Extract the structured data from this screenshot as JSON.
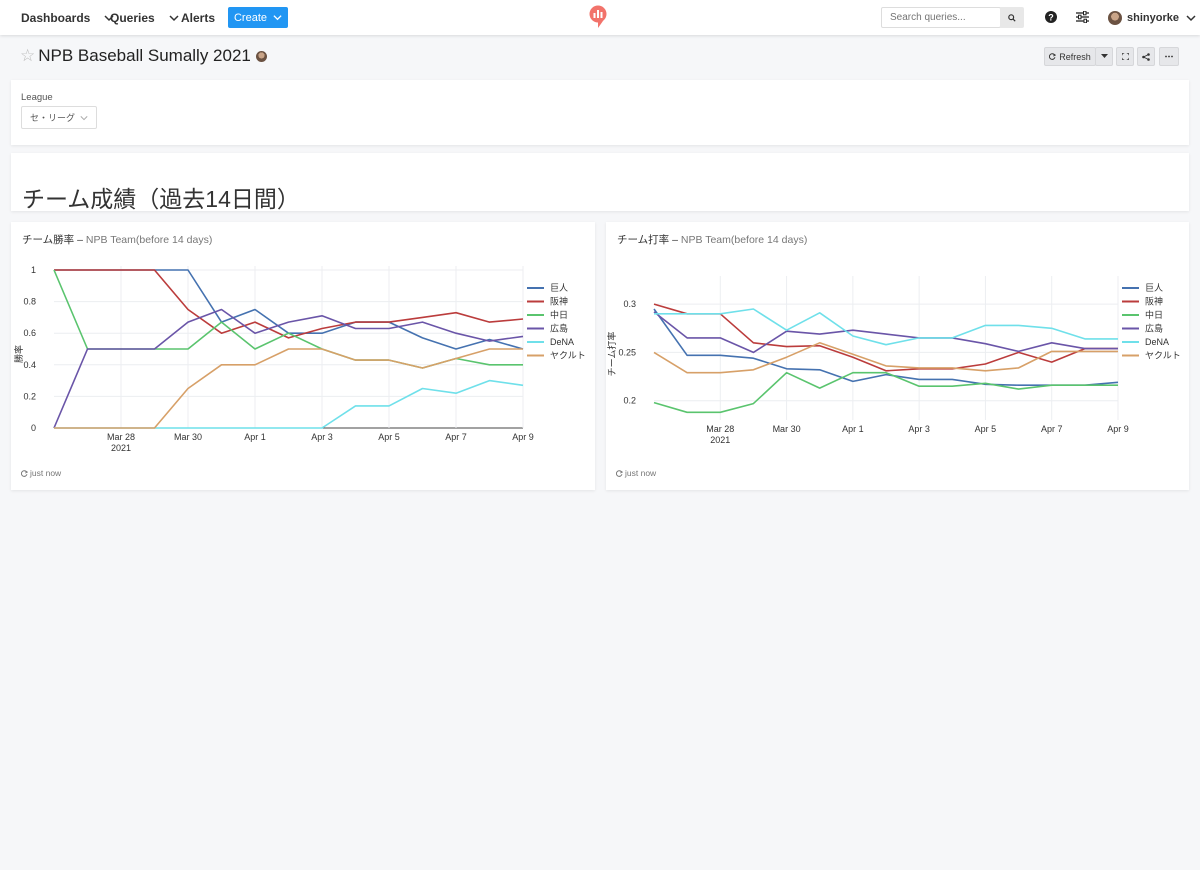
{
  "nav": {
    "dashboards": "Dashboards",
    "queries": "Queries",
    "alerts": "Alerts",
    "create": "Create",
    "search_placeholder": "Search queries...",
    "username": "shinyorke"
  },
  "dashboard": {
    "title": "NPB Baseball Sumally 2021",
    "refresh": "Refresh"
  },
  "param": {
    "label": "League",
    "value": "セ・リーグ"
  },
  "section": {
    "title": "チーム成績（過去14日間）"
  },
  "widgets": [
    {
      "title": "チーム勝率",
      "sep": "–",
      "query": "NPB Team(before 14 days)",
      "updated": "just now"
    },
    {
      "title": "チーム打率",
      "sep": "–",
      "query": "NPB Team(before 14 days)",
      "updated": "just now"
    }
  ],
  "chart_data": [
    {
      "type": "line",
      "title": "",
      "xlabel": "",
      "ylabel": "勝率",
      "x": [
        "Mar 26",
        "Mar 27",
        "Mar 28",
        "Mar 29",
        "Mar 30",
        "Mar 31",
        "Apr 1",
        "Apr 2",
        "Apr 3",
        "Apr 4",
        "Apr 5",
        "Apr 6",
        "Apr 7",
        "Apr 8",
        "Apr 9"
      ],
      "x_ticks": [
        "Mar 28\n2021",
        "Mar 30",
        "Apr 1",
        "Apr 3",
        "Apr 5",
        "Apr 7",
        "Apr 9"
      ],
      "ylim": [
        0,
        1
      ],
      "y_ticks": [
        0,
        0.2,
        0.4,
        0.6,
        0.8,
        1
      ],
      "y_tick_labels": [
        "0",
        "0.2",
        "0.4",
        "0.6",
        "0.8",
        "1"
      ],
      "grid": true,
      "legend": "right",
      "series": [
        {
          "name": "巨人",
          "color": "#4572b0",
          "values": [
            1,
            1,
            1,
            1,
            1,
            0.67,
            0.75,
            0.6,
            0.6,
            0.67,
            0.67,
            0.57,
            0.5,
            0.56,
            0.5
          ]
        },
        {
          "name": "阪神",
          "color": "#bb3c3c",
          "values": [
            1,
            1,
            1,
            1,
            0.75,
            0.6,
            0.67,
            0.57,
            0.63,
            0.67,
            0.67,
            0.7,
            0.73,
            0.67,
            0.69
          ]
        },
        {
          "name": "中日",
          "color": "#5ac46e",
          "values": [
            1,
            0.5,
            0.5,
            0.5,
            0.5,
            0.67,
            0.5,
            0.6,
            0.5,
            0.43,
            0.43,
            0.38,
            0.44,
            0.4,
            0.4
          ]
        },
        {
          "name": "広島",
          "color": "#6a55a8",
          "values": [
            0,
            0.5,
            0.5,
            0.5,
            0.67,
            0.75,
            0.6,
            0.67,
            0.71,
            0.63,
            0.63,
            0.67,
            0.6,
            0.55,
            0.58
          ]
        },
        {
          "name": "DeNA",
          "color": "#6fe0ea",
          "values": [
            0,
            0,
            0,
            0,
            0,
            0,
            0,
            0,
            0,
            0.14,
            0.14,
            0.25,
            0.22,
            0.3,
            0.27
          ]
        },
        {
          "name": "ヤクルト",
          "color": "#d7a068",
          "values": [
            0,
            0,
            0,
            0,
            0.25,
            0.4,
            0.4,
            0.5,
            0.5,
            0.43,
            0.43,
            0.38,
            0.44,
            0.5,
            0.5
          ]
        }
      ]
    },
    {
      "type": "line",
      "title": "",
      "xlabel": "",
      "ylabel": "チーム打率",
      "x": [
        "Mar 26",
        "Mar 27",
        "Mar 28",
        "Mar 29",
        "Mar 30",
        "Mar 31",
        "Apr 1",
        "Apr 2",
        "Apr 3",
        "Apr 4",
        "Apr 5",
        "Apr 6",
        "Apr 7",
        "Apr 8",
        "Apr 9"
      ],
      "x_ticks": [
        "Mar 28\n2021",
        "Mar 30",
        "Apr 1",
        "Apr 3",
        "Apr 5",
        "Apr 7",
        "Apr 9"
      ],
      "ylim": [
        0.18,
        0.325
      ],
      "y_ticks": [
        0.2,
        0.25,
        0.3
      ],
      "y_tick_labels": [
        "0.2",
        "0.25",
        "0.3"
      ],
      "grid": true,
      "legend": "right",
      "series": [
        {
          "name": "巨人",
          "color": "#4572b0",
          "values": [
            0.295,
            0.247,
            0.247,
            0.244,
            0.233,
            0.232,
            0.22,
            0.227,
            0.222,
            0.222,
            0.217,
            0.216,
            0.216,
            0.216,
            0.219
          ]
        },
        {
          "name": "阪神",
          "color": "#bb3c3c",
          "values": [
            0.3,
            0.29,
            0.29,
            0.26,
            0.256,
            0.257,
            0.245,
            0.231,
            0.233,
            0.233,
            0.238,
            0.25,
            0.24,
            0.254,
            0.254
          ]
        },
        {
          "name": "中日",
          "color": "#5ac46e",
          "values": [
            0.198,
            0.188,
            0.188,
            0.197,
            0.229,
            0.213,
            0.229,
            0.229,
            0.215,
            0.215,
            0.218,
            0.212,
            0.216,
            0.216,
            0.216
          ]
        },
        {
          "name": "広島",
          "color": "#6a55a8",
          "values": [
            0.292,
            0.265,
            0.265,
            0.25,
            0.272,
            0.269,
            0.273,
            0.269,
            0.265,
            0.265,
            0.259,
            0.251,
            0.26,
            0.254,
            0.254
          ]
        },
        {
          "name": "DeNA",
          "color": "#6fe0ea",
          "values": [
            0.29,
            0.29,
            0.29,
            0.295,
            0.273,
            0.291,
            0.267,
            0.258,
            0.265,
            0.265,
            0.278,
            0.278,
            0.275,
            0.264,
            0.264
          ]
        },
        {
          "name": "ヤクルト",
          "color": "#d7a068",
          "values": [
            0.25,
            0.229,
            0.229,
            0.232,
            0.245,
            0.26,
            0.248,
            0.236,
            0.234,
            0.234,
            0.231,
            0.234,
            0.251,
            0.251,
            0.251
          ]
        }
      ]
    }
  ]
}
